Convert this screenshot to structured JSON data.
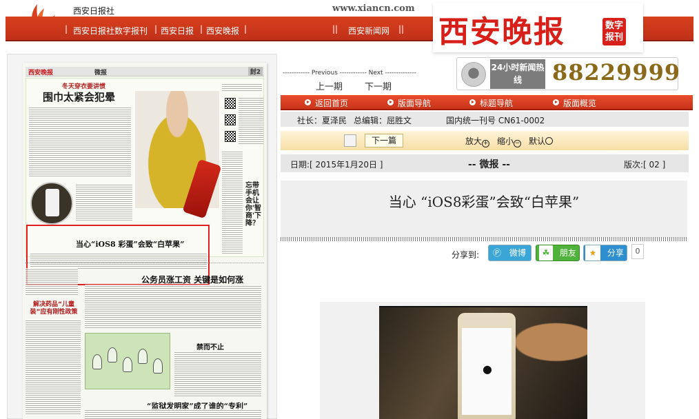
{
  "header": {
    "org_name": "西安日报社",
    "site_url": "www.xiancn.com",
    "nav": [
      "西安日报社数字报刊",
      "西安日报",
      "西安晚报",
      "西安新闻网"
    ],
    "brand_title": "西安晚报",
    "brand_tag": "数字报刊"
  },
  "paper": {
    "logo": "西安晚报",
    "category": "微报",
    "page": "封2",
    "lead_sub": "冬天穿衣要讲惯",
    "lead_head": "围巾太紧会犯晕",
    "side_title": "忘带手机会让你'智商'下降？",
    "ios_headline": "当心“iOS8 彩蛋”会致“白苹果”",
    "lower_head": "公务员涨工资 关键是如何涨",
    "side_head": "解决药品“儿童装”应有刚性政策",
    "mini_head": "禁而不止",
    "bottom_head": "“监狱发明家”成了谁的“专利”"
  },
  "pager": {
    "prev_label": "Previous",
    "next_label": "Next",
    "prev": "上一期",
    "next": "下一期"
  },
  "hotline": {
    "label": "24小时新闻热线",
    "number": "88229999"
  },
  "tabs": [
    "返回首页",
    "版面导航",
    "标题导航",
    "版面概览"
  ],
  "info": {
    "president": "社长：夏泽民",
    "editor": "总编辑：屈胜文",
    "issn": "国内统一刊号 CN61-0002"
  },
  "toolbar": {
    "next_article": "下一篇",
    "zoom_in": "放大",
    "zoom_out": "缩小",
    "default": "默认"
  },
  "datebar": {
    "date": "日期:[ 2015年1月20日 ]",
    "section": "-- 微报 --",
    "page_no": "版次:[ 02 ]"
  },
  "article": {
    "title": "当心 “iOS8彩蛋”会致“白苹果”"
  },
  "share": {
    "label": "分享到:",
    "weibo": "微博",
    "friends": "朋友",
    "share": "分享",
    "count": "0"
  },
  "colors": {
    "brand_red": "#d8201a",
    "nav_red": "#c9341a",
    "hotline_gold": "#8a6a1a"
  }
}
